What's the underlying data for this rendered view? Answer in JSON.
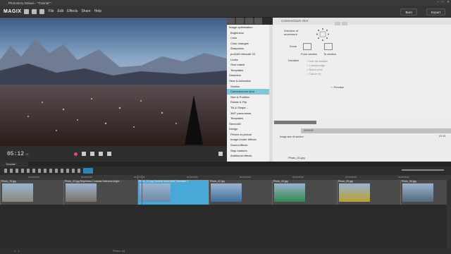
{
  "window": {
    "title": "Photostory Deluxe - \"Tutorial*\""
  },
  "menu": {
    "logo": "MAGIX",
    "items": [
      "File",
      "Edit",
      "Effects",
      "Share",
      "Help"
    ],
    "burn": "Burn",
    "export": "Export"
  },
  "preview": {
    "timecode": "05:12",
    "timecode_frames": "13"
  },
  "effects_tabs": [
    "tab1",
    "tab2",
    "tab3",
    "tab4"
  ],
  "effects_list": [
    {
      "label": "Image optimization",
      "sub": false,
      "selected": false
    },
    {
      "label": "Brightness",
      "sub": true,
      "selected": false
    },
    {
      "label": "Color",
      "sub": true,
      "selected": false
    },
    {
      "label": "Color changes",
      "sub": true,
      "selected": false
    },
    {
      "label": "Sharpness",
      "sub": true,
      "selected": false
    },
    {
      "label": "proDAD Mercalli V2",
      "sub": true,
      "selected": false
    },
    {
      "label": "Looks",
      "sub": true,
      "selected": false
    },
    {
      "label": "Shot match",
      "sub": true,
      "selected": false
    },
    {
      "label": "Templates",
      "sub": true,
      "selected": false
    },
    {
      "label": "Distortion",
      "sub": false,
      "selected": false
    },
    {
      "label": "View & Animation",
      "sub": false,
      "selected": false
    },
    {
      "label": "Section",
      "sub": true,
      "selected": false
    },
    {
      "label": "Camera/zoom shot",
      "sub": true,
      "selected": true
    },
    {
      "label": "Size & Position",
      "sub": true,
      "selected": false
    },
    {
      "label": "Rotate & Flip",
      "sub": true,
      "selected": false
    },
    {
      "label": "Tilt & Shape...",
      "sub": true,
      "selected": false
    },
    {
      "label": "360° panoramas",
      "sub": true,
      "selected": false
    },
    {
      "label": "Templates",
      "sub": true,
      "selected": false
    },
    {
      "label": "Stereo3D",
      "sub": false,
      "selected": false
    },
    {
      "label": "Design",
      "sub": false,
      "selected": false
    },
    {
      "label": "Picture-in-picture",
      "sub": true,
      "selected": false
    },
    {
      "label": "Image border effects",
      "sub": true,
      "selected": false
    },
    {
      "label": "Sound effects",
      "sub": true,
      "selected": false
    },
    {
      "label": "Stop markers",
      "sub": true,
      "selected": false
    },
    {
      "label": "Additional effects",
      "sub": true,
      "selected": false
    }
  ],
  "props": {
    "header": "Camera/zoom shot",
    "direction_label": "Direction of movement",
    "zoom_label": "Zoom",
    "from_section": "From section",
    "to_section": "To section",
    "duration_label": "Duration",
    "options": [
      "Over full duration",
      "1 second edge",
      "Slow in prod",
      "Custom (0)"
    ],
    "preview": "Preview"
  },
  "keyframe": {
    "time_start": "00:00:00",
    "time_end": "07:13",
    "file": "Photo_01.jpg",
    "dropdown": "Image size 4k section"
  },
  "timeline": {
    "tab": "Tutorial*",
    "ruler": [
      "00:00:00:00",
      "00:00:05:00",
      "00:00:10:00",
      "00:00:15:00",
      "00:00:20:00",
      "00:00:25:00",
      "00:00:30:00",
      "00:00:35:00",
      "00:00:40:00"
    ],
    "clips": [
      {
        "label": "Photo_76.jpg",
        "color": "#4a4a4a"
      },
      {
        "label": "Photo_03.jpg Brightness Contrast Selective bright...",
        "color": "#4a4a4a"
      },
      {
        "label": "Photo_01.jpg Camera zoom shot Transition 1",
        "color": "#49a8d8"
      },
      {
        "label": "Photo_02.jpg",
        "color": "#4a4a4a"
      },
      {
        "label": "Photo_04.jpg",
        "color": "#4a4a4a"
      },
      {
        "label": "Photo_05.jpg",
        "color": "#4a4a4a"
      },
      {
        "label": "Photo_06.jpg",
        "color": "#4a4a4a"
      }
    ]
  },
  "status": {
    "left": "1 : 1",
    "right": "Photo: 44"
  }
}
